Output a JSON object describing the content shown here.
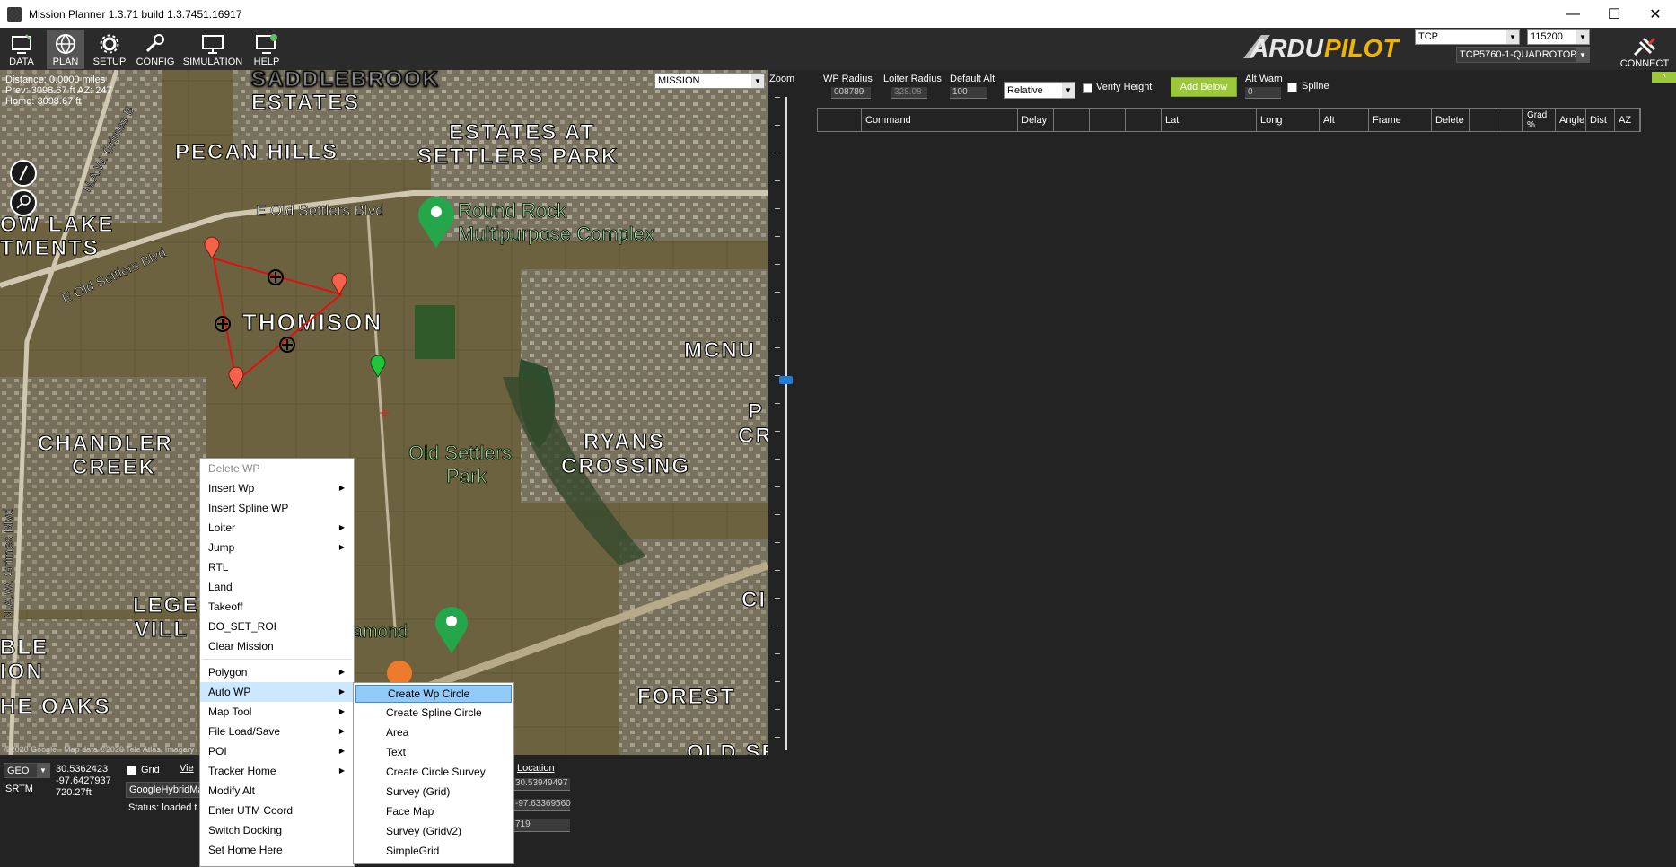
{
  "window": {
    "title": "Mission Planner 1.3.71 build 1.3.7451.16917",
    "min": "—",
    "max": "☐",
    "close": "✕"
  },
  "nav": [
    {
      "label": "DATA"
    },
    {
      "label": "PLAN"
    },
    {
      "label": "SETUP"
    },
    {
      "label": "CONFIG"
    },
    {
      "label": "SIMULATION"
    },
    {
      "label": "HELP"
    }
  ],
  "connection": {
    "type": "TCP",
    "baud": "115200",
    "target": "TCP5760-1-QUADROTOR",
    "connect_label": "CONNECT"
  },
  "map": {
    "mode_select": "MISSION",
    "distance": "Distance: 0.0000 miles",
    "prev": "Prev: 3098.67 ft AZ: 247",
    "home": "Home: 3098.67 ft",
    "labels": [
      "SADDLEBROOK",
      "ESTATES",
      "PECAN HILLS",
      "ESTATES AT",
      "SETTLERS PARK",
      "THOMISON",
      "MCNU",
      "CHANDLER",
      "CREEK",
      "RYANS",
      "CROSSING",
      "LEGE",
      "VILL",
      "BLE",
      "ION",
      "HE OAKS",
      "FOREST",
      "OW LAKE",
      "TMENTS",
      "P",
      "CR",
      "CI",
      "OLD SE"
    ],
    "roads": [
      "E Old Settlers Blvd",
      "E Old Settlers Blvd",
      "N.A.W. Grimes B",
      "N.A.W. Grimes Blvd"
    ],
    "places": [
      "Round Rock",
      "Multipurpose Complex",
      "Old Settlers",
      "Park",
      "amond"
    ],
    "copyright": "©2020 Google · Map data ©2020 Tele Atlas, Imagery"
  },
  "zoom_label": "Zoom",
  "wp": {
    "radius_label": "WP Radius",
    "radius_value": "008789",
    "loiter_label": "Loiter Radius",
    "loiter_value": "328.08",
    "alt_label": "Default Alt",
    "alt_value": "100",
    "frame": "Relative",
    "verify_label": "Verify Height",
    "add_below": "Add Below",
    "altwarn_label": "Alt Warn",
    "altwarn_value": "0",
    "spline_label": "Spline",
    "columns": [
      "",
      "Command",
      "Delay",
      "",
      "",
      "",
      "Lat",
      "Long",
      "Alt",
      "Frame",
      "Delete",
      "",
      "",
      "Grad %",
      "Angle",
      "Dist",
      "AZ"
    ]
  },
  "bottom": {
    "coord_type": "GEO",
    "lat": "30.5362423",
    "lng": "-97.6427937",
    "alt": "720.27ft",
    "srtm": "SRTM",
    "grid_label": "Grid",
    "view_label": "Vie",
    "map_provider": "GoogleHybridMa",
    "status": "Status: loaded t",
    "location_label": "Location",
    "loc1": "30.53949497",
    "loc2": "-97.63369560",
    "loc3": "719"
  },
  "context_menu": {
    "items": [
      {
        "label": "Delete WP",
        "disabled": true
      },
      {
        "label": "Insert Wp",
        "sub": true
      },
      {
        "label": "Insert Spline WP"
      },
      {
        "label": "Loiter",
        "sub": true
      },
      {
        "label": "Jump",
        "sub": true
      },
      {
        "label": "RTL"
      },
      {
        "label": "Land"
      },
      {
        "label": "Takeoff"
      },
      {
        "label": "DO_SET_ROI"
      },
      {
        "label": "Clear Mission"
      },
      {
        "sep": true
      },
      {
        "label": "Polygon",
        "sub": true
      },
      {
        "label": "Auto WP",
        "sub": true,
        "hl": true
      },
      {
        "label": "Map Tool",
        "sub": true
      },
      {
        "label": "File Load/Save",
        "sub": true
      },
      {
        "label": "POI",
        "sub": true
      },
      {
        "label": "Tracker Home",
        "sub": true
      },
      {
        "label": "Modify Alt"
      },
      {
        "label": "Enter UTM Coord"
      },
      {
        "label": "Switch Docking"
      },
      {
        "label": "Set Home Here"
      }
    ],
    "submenu": [
      "Create Wp Circle",
      "Create Spline Circle",
      "Area",
      "Text",
      "Create Circle Survey",
      "Survey (Grid)",
      "Face Map",
      "Survey (Gridv2)",
      "SimpleGrid"
    ]
  }
}
